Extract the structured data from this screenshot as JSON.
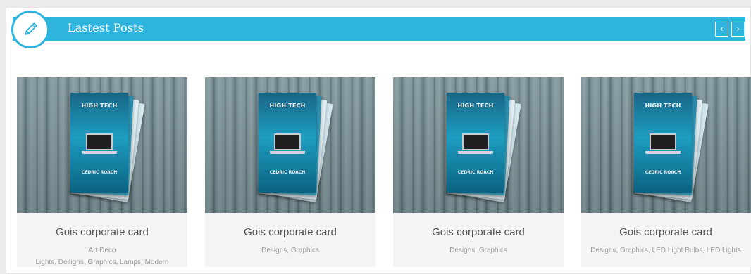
{
  "header": {
    "title": "Lastest Posts",
    "accent_color": "#2fb4dd",
    "icon": "pencil-icon",
    "prev_label": "‹",
    "next_label": "›"
  },
  "posts": [
    {
      "title": "Gois corporate card",
      "categories": "Art Deco\nLights, Designs, Graphics, Lamps, Modern",
      "brochure_title": "HIGH TECH",
      "brochure_name": "CEDRIC ROACH"
    },
    {
      "title": "Gois corporate card",
      "categories": "Designs, Graphics",
      "brochure_title": "HIGH TECH",
      "brochure_name": "CEDRIC ROACH"
    },
    {
      "title": "Gois corporate card",
      "categories": "Designs, Graphics",
      "brochure_title": "HIGH TECH",
      "brochure_name": "CEDRIC ROACH"
    },
    {
      "title": "Gois corporate card",
      "categories": "Designs, Graphics, LED Light Bulbs, LED Lights",
      "brochure_title": "HIGH TECH",
      "brochure_name": "CEDRIC ROACH"
    }
  ]
}
